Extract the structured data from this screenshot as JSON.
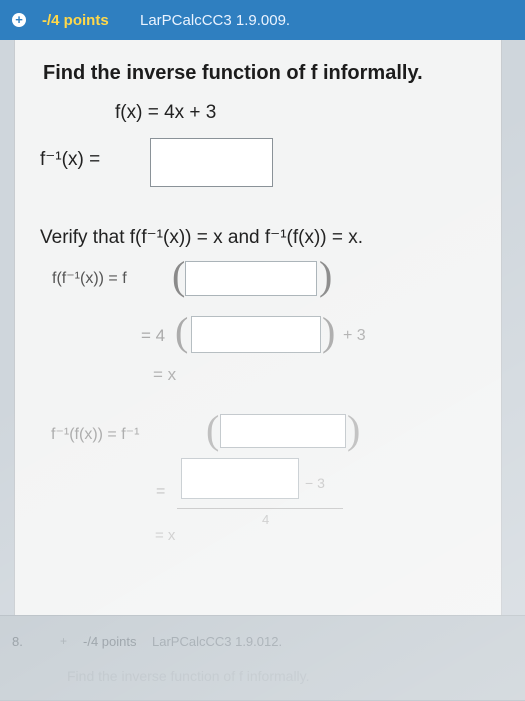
{
  "header": {
    "expand_icon": "+",
    "points": "-/4 points",
    "code": "LarPCalcCC3 1.9.009."
  },
  "problem": {
    "title": "Find the inverse function of f informally.",
    "function": "f(x) = 4x + 3",
    "inverse_label": "f⁻¹(x) =",
    "verify_text": "Verify that f(f⁻¹(x)) = x and f⁻¹(f(x)) = x.",
    "row1_label": "f(f⁻¹(x)) = f",
    "row2_label": "= 4",
    "row2_suffix": "+ 3",
    "row3_label": "= x",
    "row4_label": "f⁻¹(f(x)) = f⁻¹",
    "row5_label": "=",
    "row5_suffix": "− 3",
    "row5_denominator": "4",
    "row6_label": "= x",
    "open_paren": "(",
    "close_paren": ")"
  },
  "footer": {
    "question_number": "8.",
    "expand_icon": "+",
    "points": "-/4 points",
    "code": "LarPCalcCC3 1.9.012.",
    "prompt": "Find the inverse function of f informally."
  }
}
